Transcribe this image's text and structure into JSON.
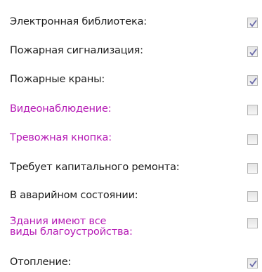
{
  "options": [
    {
      "label": "Электронная библиотека:",
      "checked": true,
      "style": "normal"
    },
    {
      "label": "Пожарная сигнализация:",
      "checked": true,
      "style": "normal"
    },
    {
      "label": "Пожарные краны:",
      "checked": true,
      "style": "normal"
    },
    {
      "label": "Видеонаблюдение:",
      "checked": false,
      "style": "highlight"
    },
    {
      "label": "Тревожная кнопка:",
      "checked": false,
      "style": "highlight"
    },
    {
      "label": "Требует капитального ремонта:",
      "checked": false,
      "style": "normal"
    },
    {
      "label": "В аварийном состоянии:",
      "checked": false,
      "style": "normal"
    },
    {
      "label": "Здания имеют все виды благоустройства:",
      "checked": false,
      "style": "highlight"
    },
    {
      "label": "Отопление:",
      "checked": true,
      "style": "normal"
    }
  ],
  "colors": {
    "label_normal": "#1c1c1c",
    "label_highlight": "#b51ab5",
    "check_mark": "#6a6aa8"
  },
  "icons": {
    "checked": "checkmark-icon"
  }
}
